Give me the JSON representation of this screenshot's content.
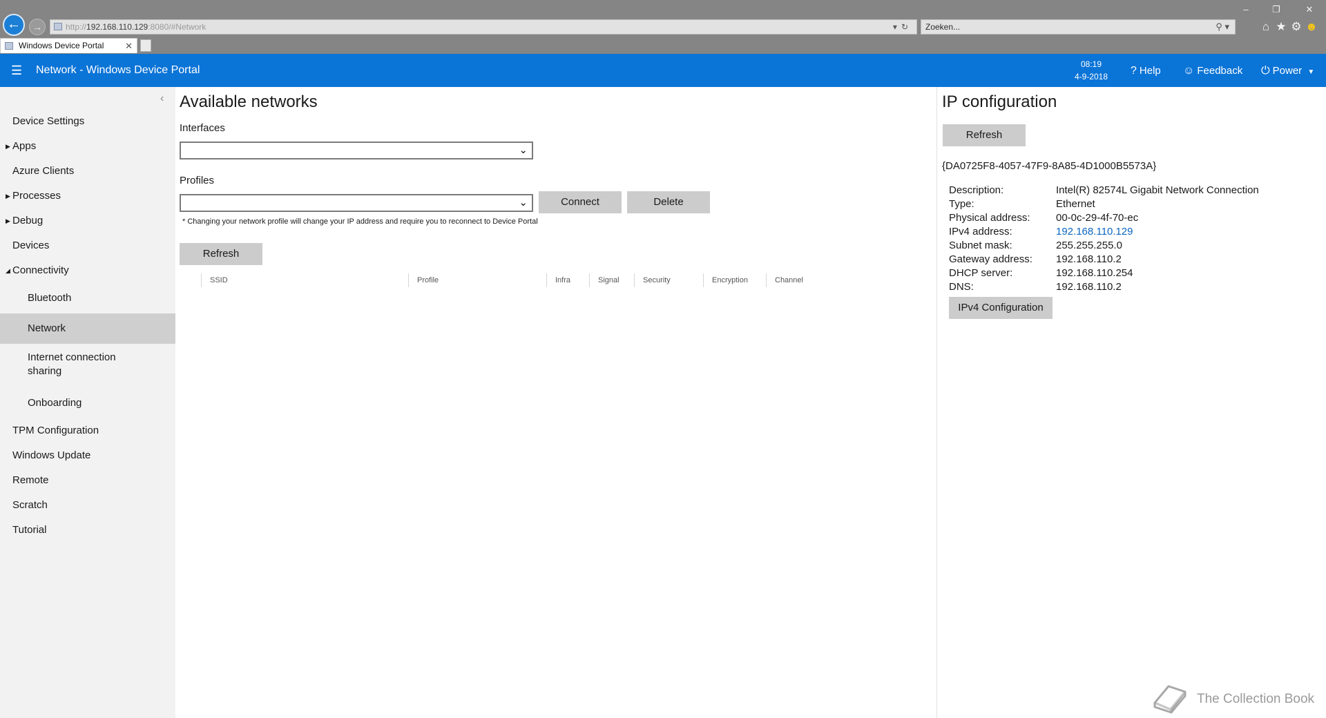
{
  "browser": {
    "address_scheme": "http://",
    "address_host": "192.168.110.129",
    "address_rest": ":8080/#Network",
    "search_placeholder": "Zoeken...",
    "tab_title": "Windows Device Portal"
  },
  "header": {
    "title": "Network - Windows Device Portal",
    "time": "08:19",
    "date": "4-9-2018",
    "help_label": "Help",
    "feedback_label": "Feedback",
    "power_label": "Power"
  },
  "sidebar": {
    "items": [
      {
        "label": "Device Settings"
      },
      {
        "label": "Apps"
      },
      {
        "label": "Azure Clients"
      },
      {
        "label": "Processes"
      },
      {
        "label": "Debug"
      },
      {
        "label": "Devices"
      },
      {
        "label": "Connectivity"
      },
      {
        "label": "Bluetooth"
      },
      {
        "label": "Network"
      },
      {
        "label": "Internet connection sharing"
      },
      {
        "label": "Onboarding"
      },
      {
        "label": "TPM Configuration"
      },
      {
        "label": "Windows Update"
      },
      {
        "label": "Remote"
      },
      {
        "label": "Scratch"
      },
      {
        "label": "Tutorial"
      }
    ]
  },
  "networks": {
    "title": "Available networks",
    "interfaces_label": "Interfaces",
    "interfaces_value": "",
    "profiles_label": "Profiles",
    "profiles_value": "",
    "connect_label": "Connect",
    "delete_label": "Delete",
    "note": "* Changing your network profile will change your IP address and require you to reconnect to Device Portal",
    "refresh_label": "Refresh",
    "columns": [
      "SSID",
      "Profile",
      "Infra",
      "Signal",
      "Security",
      "Encryption",
      "Channel"
    ]
  },
  "ip_config": {
    "title": "IP configuration",
    "refresh_label": "Refresh",
    "adapter_id": "{DA0725F8-4057-47F9-8A85-4D1000B5573A}",
    "rows": [
      {
        "key": "Description:",
        "value": "Intel(R) 82574L Gigabit Network Connection"
      },
      {
        "key": "Type:",
        "value": "Ethernet"
      },
      {
        "key": "Physical address:",
        "value": "00-0c-29-4f-70-ec"
      },
      {
        "key": "IPv4 address:",
        "value": "192.168.110.129"
      },
      {
        "key": "Subnet mask:",
        "value": "255.255.255.0"
      },
      {
        "key": "Gateway address:",
        "value": "192.168.110.2"
      },
      {
        "key": "DHCP server:",
        "value": "192.168.110.254"
      },
      {
        "key": "DNS:",
        "value": "192.168.110.2"
      }
    ],
    "ipv4_button_label": "IPv4 Configuration"
  },
  "watermark": {
    "text": "The Collection Book"
  },
  "colors": {
    "header_blue": "#0b74d7",
    "link_blue": "#0b66c2",
    "sidebar_bg": "#f2f2f2",
    "sidebar_active": "#cfcfcf",
    "button_gray": "#cccccc"
  },
  "icons": {
    "back": "back-arrow-icon",
    "forward": "forward-arrow-icon",
    "refresh": "refresh-icon",
    "search": "magnifier-icon",
    "home": "home-icon",
    "favorites": "star-icon",
    "settings": "gear-icon",
    "smiley": "smiley-icon",
    "help": "question-icon",
    "feedback": "smiley-icon",
    "power": "power-icon",
    "menu": "hamburger-icon"
  }
}
